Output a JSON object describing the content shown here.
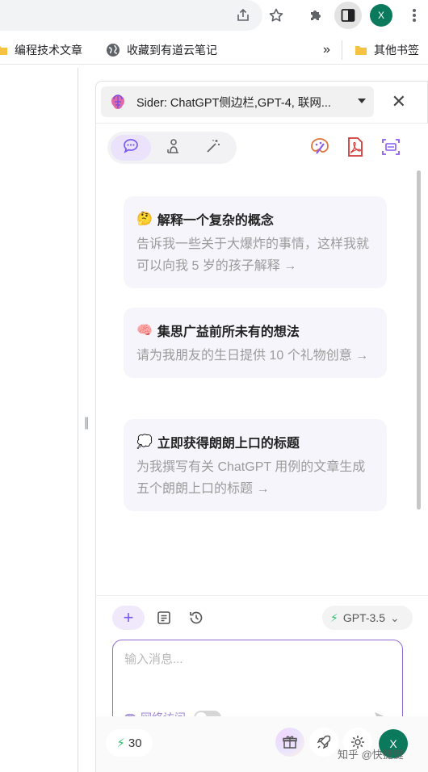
{
  "browser": {
    "profile_initial": "X",
    "toolbar_icons": [
      "share-icon",
      "star-icon",
      "puzzle-icon",
      "side-panel-icon",
      "kebab-menu-icon"
    ]
  },
  "bookmarks": {
    "items": [
      {
        "label": "编程技术文章",
        "icon": "folder-icon"
      },
      {
        "label": "收藏到有道云笔记",
        "icon": "globe-icon"
      }
    ],
    "overflow": "»",
    "other": "其他书签"
  },
  "sider": {
    "title": "Sider: ChatGPT侧边栏,GPT-4, 联网...",
    "tabs": [
      "chat-tab",
      "read-tab",
      "write-tab"
    ],
    "tools": [
      "paint-icon",
      "pdf-icon",
      "screenshot-icon"
    ],
    "prompts": [
      {
        "emoji": "🤔",
        "title": "解释一个复杂的概念",
        "desc": "告诉我一些关于大爆炸的事情，这样我就可以向我 5 岁的孩子解释 →"
      },
      {
        "emoji": "🧠",
        "title": "集思广益前所未有的想法",
        "desc": "请为我朋友的生日提供 10 个礼物创意 →"
      },
      {
        "emoji": "💭",
        "title": "立即获得朗朗上口的标题",
        "desc": "为我撰写有关 ChatGPT 用例的文章生成五个朗朗上口的标题 →"
      }
    ],
    "model": "GPT-3.5",
    "input_placeholder": "输入消息...",
    "web_access_label": "网络访问",
    "web_access_on": false,
    "credits": "30",
    "user_initial": "X"
  },
  "watermark": "知乎 @快捷键"
}
